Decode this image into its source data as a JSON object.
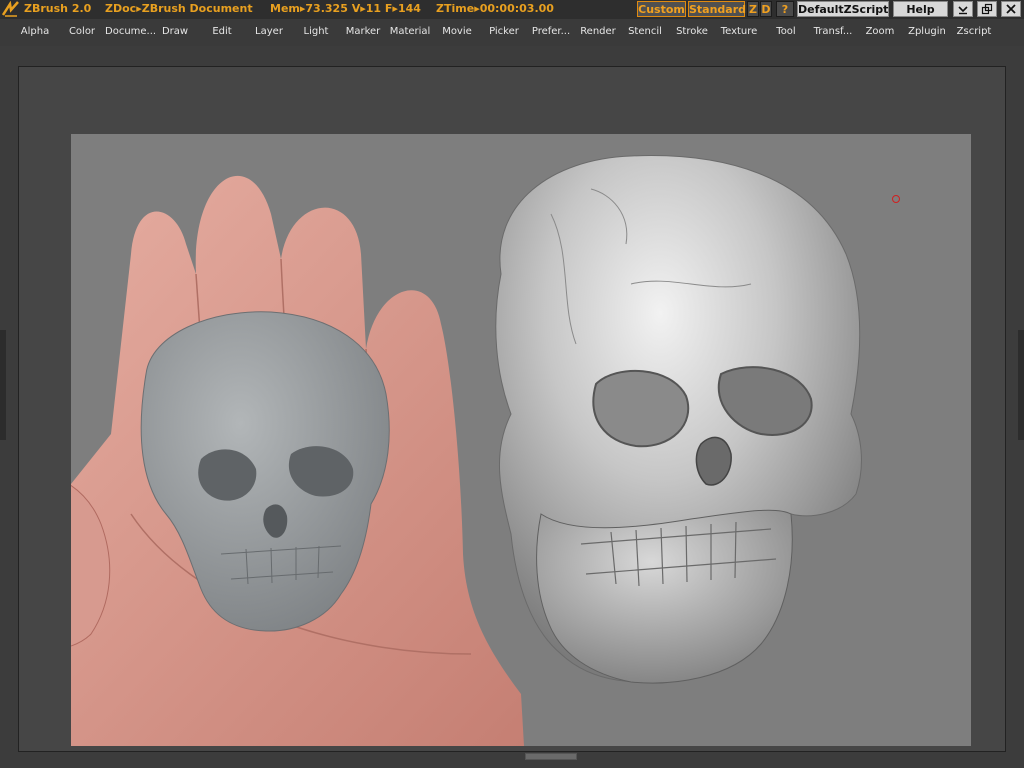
{
  "app": {
    "title": "ZBrush 2.0",
    "doc_label": "ZDoc",
    "doc_name": "ZBrush Document",
    "mem_label": "Mem",
    "mem_value": "73.325",
    "v_label": "V",
    "v_value": "11",
    "f_label": "F",
    "f_value": "144",
    "ztime_label": "ZTime",
    "ztime_value": "00:00:03.00"
  },
  "toolbar": {
    "custom": "Custom",
    "standard": "Standard",
    "z": "Z",
    "d": "D",
    "question": "?",
    "default_zscript": "DefaultZScript",
    "help": "Help"
  },
  "menus": [
    "Alpha",
    "Color",
    "Docume...",
    "Draw",
    "Edit",
    "Layer",
    "Light",
    "Marker",
    "Material",
    "Movie",
    "Picker",
    "Prefer...",
    "Render",
    "Stencil",
    "Stroke",
    "Texture",
    "Tool",
    "Transf...",
    "Zoom",
    "Zplugin",
    "Zscript"
  ],
  "colors": {
    "accent": "#e8a020",
    "canvas": "#7e7e7e",
    "marker": "#d02020"
  },
  "icons": {
    "logo": "zbrush-logo-icon",
    "minimize": "minimize-icon",
    "restore": "restore-icon",
    "close": "close-icon"
  }
}
